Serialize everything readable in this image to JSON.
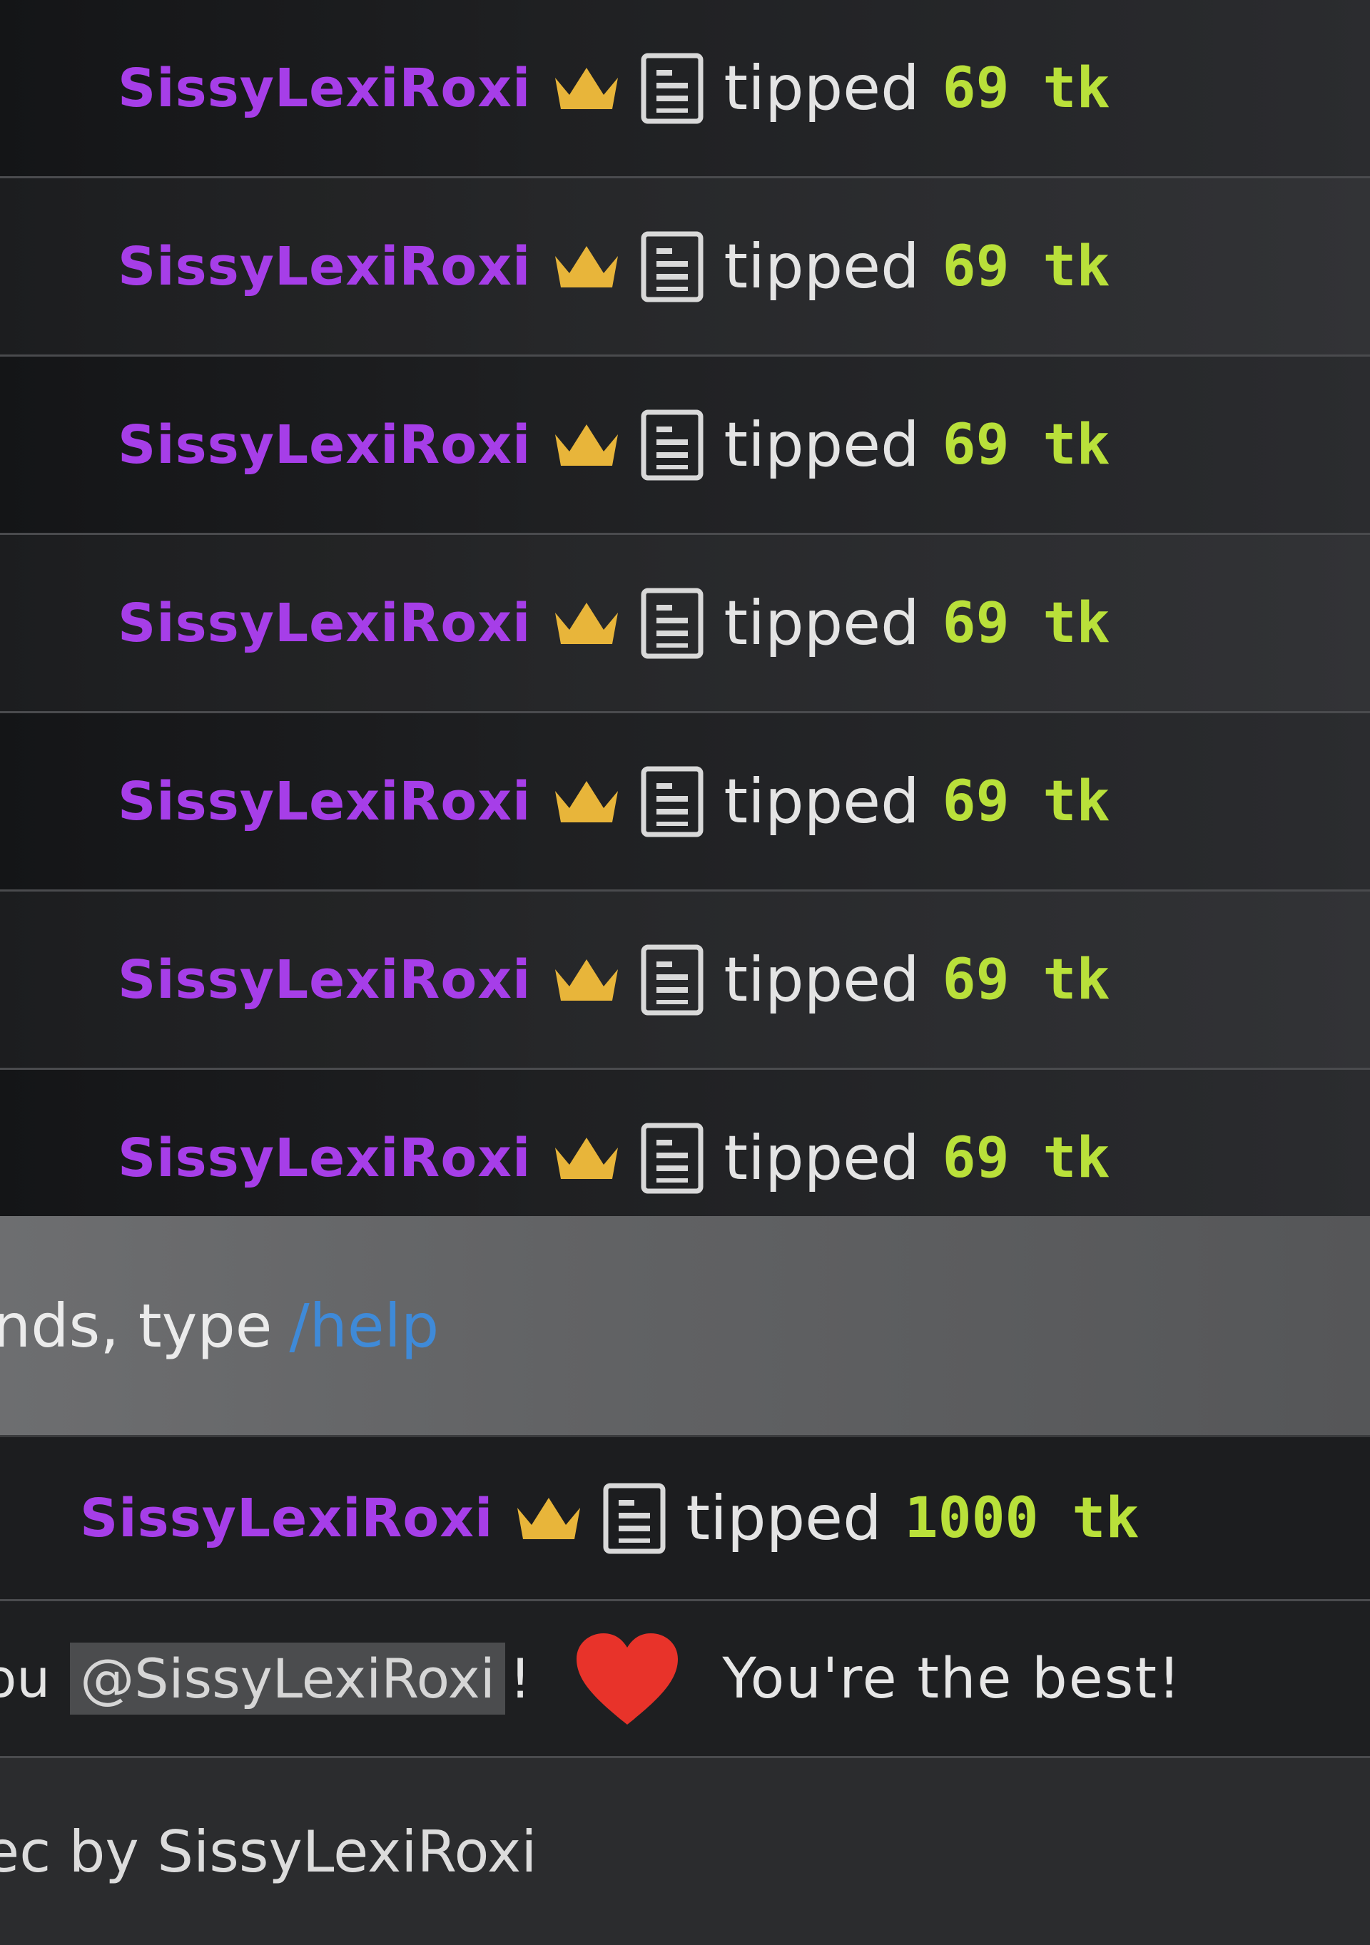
{
  "chat": {
    "tips": [
      {
        "username": "SissyLexiRoxi",
        "action": "tipped",
        "amount": "69 tk"
      },
      {
        "username": "SissyLexiRoxi",
        "action": "tipped",
        "amount": "69 tk"
      },
      {
        "username": "SissyLexiRoxi",
        "action": "tipped",
        "amount": "69 tk"
      },
      {
        "username": "SissyLexiRoxi",
        "action": "tipped",
        "amount": "69 tk"
      },
      {
        "username": "SissyLexiRoxi",
        "action": "tipped",
        "amount": "69 tk"
      },
      {
        "username": "SissyLexiRoxi",
        "action": "tipped",
        "amount": "69 tk"
      },
      {
        "username": "SissyLexiRoxi",
        "action": "tipped",
        "amount": "69 tk"
      }
    ],
    "help_notice": {
      "text": "nds, type",
      "command": "/help"
    },
    "big_tip": {
      "username": "SissyLexiRoxi",
      "action": "tipped",
      "amount": "1000 tk"
    },
    "thanks": {
      "prefix": "ou",
      "mention": "@SissyLexiRoxi",
      "excl": "!",
      "icon": "heart-icon",
      "suffix": "You're the best!"
    },
    "footer": {
      "text": "ec by SissyLexiRoxi"
    }
  },
  "icons": {
    "crown": "crown-icon",
    "badge": "badge-icon"
  },
  "colors": {
    "username": "#a63ee8",
    "amount": "#b9e03a",
    "command_link": "#3f8ad8",
    "heart": "#e8332a",
    "crown": "#e8b53a"
  }
}
